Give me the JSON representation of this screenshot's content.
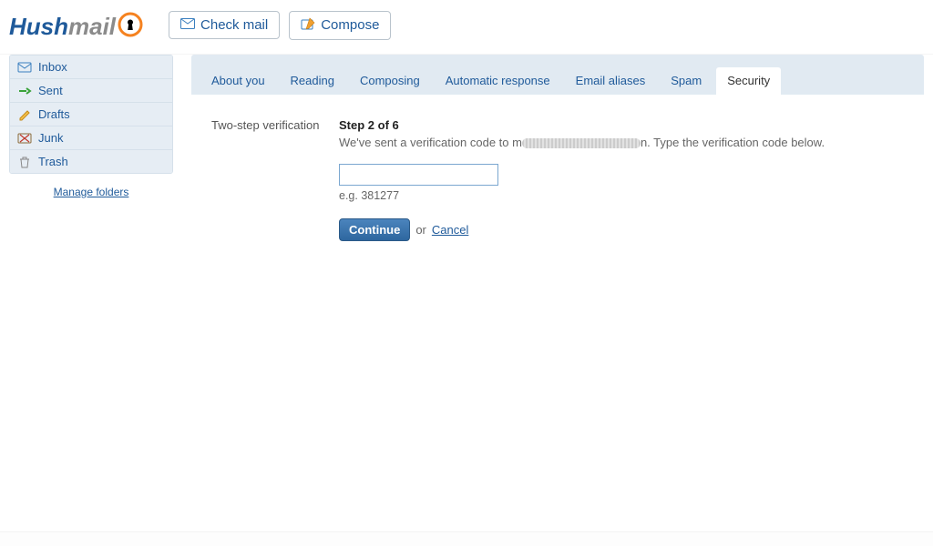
{
  "header": {
    "brand_part1": "Hush",
    "brand_part2": "mail",
    "check_mail": "Check mail",
    "compose": "Compose"
  },
  "sidebar": {
    "folders": [
      {
        "label": "Inbox",
        "icon": "inbox-icon"
      },
      {
        "label": "Sent",
        "icon": "sent-icon"
      },
      {
        "label": "Drafts",
        "icon": "drafts-icon"
      },
      {
        "label": "Junk",
        "icon": "junk-icon"
      },
      {
        "label": "Trash",
        "icon": "trash-icon"
      }
    ],
    "manage_label": "Manage folders"
  },
  "tabs": [
    {
      "label": "About you",
      "active": false
    },
    {
      "label": "Reading",
      "active": false
    },
    {
      "label": "Composing",
      "active": false
    },
    {
      "label": "Automatic response",
      "active": false
    },
    {
      "label": "Email aliases",
      "active": false
    },
    {
      "label": "Spam",
      "active": false
    },
    {
      "label": "Security",
      "active": true
    }
  ],
  "panel": {
    "row_label": "Two-step verification",
    "step_title": "Step 2 of 6",
    "msg_prefix": "We've sent a verification code to m",
    "msg_suffix": "n. Type the verification code below.",
    "input_value": "",
    "example": "e.g. 381277",
    "continue": "Continue",
    "or": "or",
    "cancel": "Cancel"
  }
}
